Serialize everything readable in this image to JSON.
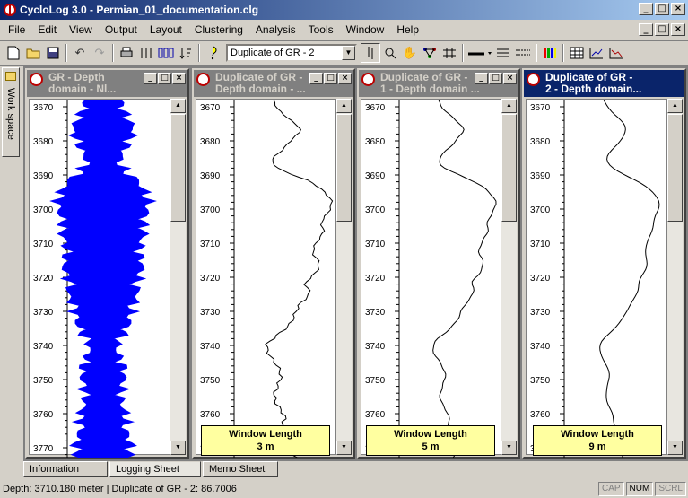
{
  "app": {
    "title": "CycloLog 3.0 - Permian_01_documentation.clg"
  },
  "menu": [
    {
      "label": "File"
    },
    {
      "label": "Edit"
    },
    {
      "label": "View"
    },
    {
      "label": "Output"
    },
    {
      "label": "Layout"
    },
    {
      "label": "Clustering"
    },
    {
      "label": "Analysis"
    },
    {
      "label": "Tools"
    },
    {
      "label": "Window"
    },
    {
      "label": "Help"
    }
  ],
  "toolbar": {
    "selected_log": "Duplicate of GR - 2"
  },
  "workspace": {
    "label": "Work space"
  },
  "depth_ticks": [
    "3670",
    "3680",
    "3690",
    "3700",
    "3710",
    "3720",
    "3730",
    "3740",
    "3750",
    "3760",
    "3770"
  ],
  "windows": [
    {
      "title_line1": "GR - Depth",
      "title_line2": "domain - Nl...",
      "active": false
    },
    {
      "title_line1": "Duplicate of GR -",
      "title_line2": "Depth domain - ...",
      "active": false,
      "window_length_label": "Window Length",
      "window_length_value": "3 m"
    },
    {
      "title_line1": "Duplicate of GR -",
      "title_line2": "1 - Depth domain ...",
      "active": false,
      "window_length_label": "Window Length",
      "window_length_value": "5 m"
    },
    {
      "title_line1": "Duplicate of GR -",
      "title_line2": "2 - Depth domain...",
      "active": true,
      "window_length_label": "Window Length",
      "window_length_value": "9 m"
    }
  ],
  "bottom_tabs": [
    {
      "label": "Information",
      "active": false
    },
    {
      "label": "Logging Sheet",
      "active": true
    },
    {
      "label": "Memo Sheet",
      "active": false
    }
  ],
  "status": {
    "text": "Depth: 3710.180 meter | Duplicate of GR - 2: 86.7006",
    "cap": "CAP",
    "num": "NUM",
    "scrl": "SCRL"
  },
  "colors": {
    "gr_fill": "#0000ff",
    "wl_box": "#ffffa0",
    "active_title": "#0a246a"
  }
}
